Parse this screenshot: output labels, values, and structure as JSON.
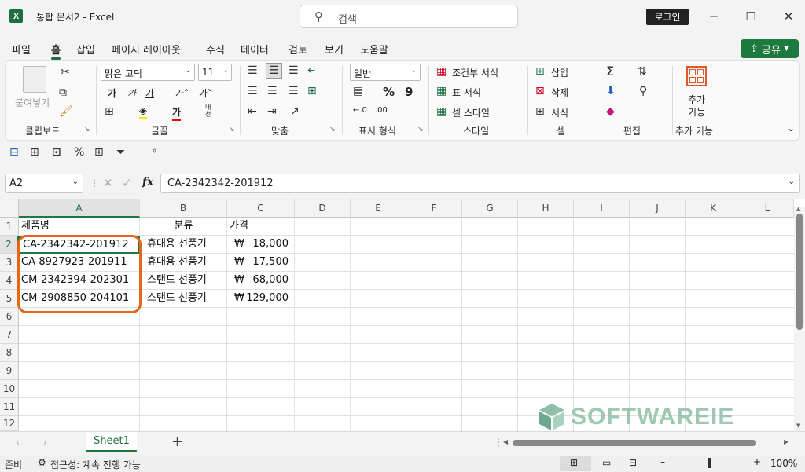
{
  "window": {
    "app_icon": "X",
    "title": "통합 문서2  -  Excel",
    "search_placeholder": "검색",
    "login_label": "로그인",
    "controls": [
      "minimize-icon",
      "maximize-icon",
      "close-icon"
    ]
  },
  "menu": {
    "items": [
      "파일",
      "홈",
      "삽입",
      "페이지 레이아웃",
      "수식",
      "데이터",
      "검토",
      "보기",
      "도움말"
    ],
    "active": "홈",
    "share_label": "공유"
  },
  "ribbon": {
    "clipboard": {
      "paste_label": "붙여넣기",
      "group_label": "클립보드"
    },
    "font": {
      "font_name": "맑은 고딕",
      "font_size": "11",
      "group_label": "글꼴",
      "vertical_text_label": "내천"
    },
    "alignment": {
      "group_label": "맞춤"
    },
    "number": {
      "format": "일반",
      "group_label": "표시 형식"
    },
    "styles": {
      "conditional": "조건부 서식",
      "table": "표 서식",
      "cell_style": "셀 스타일",
      "group_label": "스타일"
    },
    "cells": {
      "insert": "삽입",
      "delete": "삭제",
      "format": "서식",
      "group_label": "셀"
    },
    "editing": {
      "group_label": "편집"
    },
    "addins": {
      "label_1": "추가",
      "label_2": "기능",
      "group_label": "추가 기능"
    }
  },
  "formula_bar": {
    "name_box": "A2",
    "fx": "fx",
    "content": "CA-2342342-201912"
  },
  "grid": {
    "columns": [
      "A",
      "B",
      "C",
      "D",
      "E",
      "F",
      "G",
      "H",
      "I",
      "J",
      "K",
      "L"
    ],
    "rows": [
      "1",
      "2",
      "3",
      "4",
      "5",
      "6",
      "7",
      "8",
      "9",
      "10",
      "11",
      "12"
    ],
    "headers": [
      "제품명",
      "분류",
      "가격"
    ],
    "data": [
      {
        "product": "CA-2342342-201912",
        "category": "휴대용 선풍기",
        "currency": "₩",
        "price": "18,000"
      },
      {
        "product": "CA-8927923-201911",
        "category": "휴대용 선풍기",
        "currency": "₩",
        "price": "17,500"
      },
      {
        "product": "CM-2342394-202301",
        "category": "스탠드 선풍기",
        "currency": "₩",
        "price": "68,000"
      },
      {
        "product": "CM-2908850-204101",
        "category": "스탠드 선풍기",
        "currency": "₩",
        "price": "129,000"
      }
    ],
    "selected_cell": "A2"
  },
  "sheets": {
    "tabs": [
      "Sheet1"
    ],
    "add_label": "+"
  },
  "status": {
    "ready": "준비",
    "accessibility": "접근성: 계속 진행 가능",
    "zoom": "100%"
  },
  "watermark": {
    "text": "SOFTWAREIE"
  },
  "colors": {
    "excel_green": "#1d6f42",
    "highlight_orange": "#e6651a"
  }
}
